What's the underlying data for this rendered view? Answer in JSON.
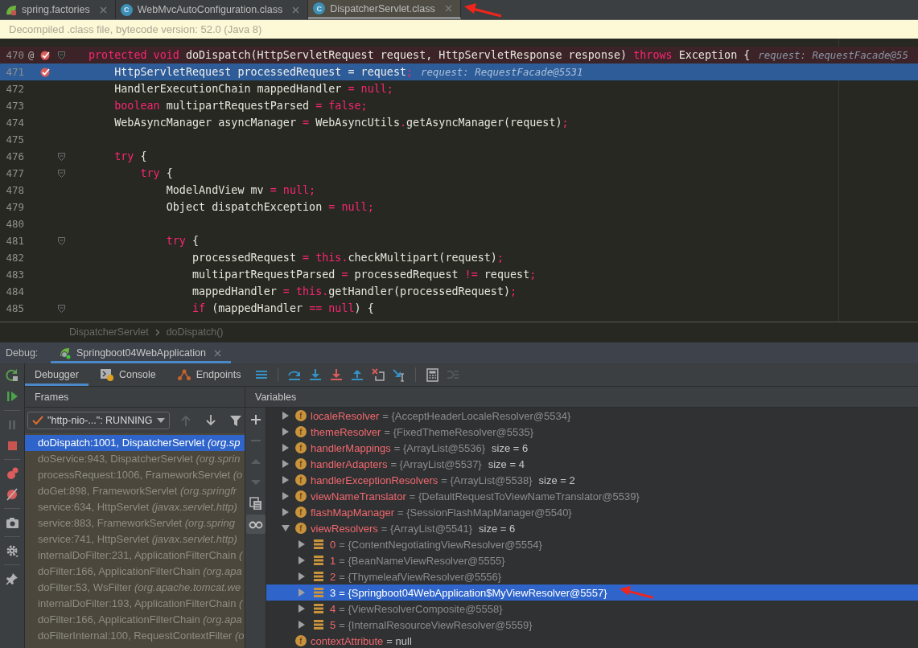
{
  "tabs": [
    {
      "label": "spring.factories",
      "kind": "spring",
      "selected": false,
      "annotated": false
    },
    {
      "label": "WebMvcAutoConfiguration.class",
      "kind": "class",
      "icon_letter": "C",
      "selected": false,
      "annotated": false
    },
    {
      "label": "DispatcherServlet.class",
      "kind": "class",
      "icon_letter": "C",
      "selected": true,
      "annotated": true
    }
  ],
  "banner": "Decompiled .class file, bytecode version: 52.0 (Java 8)",
  "editor": {
    "lines": [
      {
        "number": "470",
        "gutter_mark": "@",
        "breakpoint": true,
        "current": false,
        "fold": true,
        "tokens": [
          {
            "kind": "kw",
            "text": "protected void "
          },
          {
            "kind": "plain",
            "text": "doDispatch(HttpServletRequest request, HttpServletResponse response) "
          },
          {
            "kind": "kw",
            "text": "throws"
          },
          {
            "kind": "plain",
            "text": " Exception {"
          }
        ],
        "hint": "request: RequestFacade@55"
      },
      {
        "number": "471",
        "breakpoint": true,
        "current": true,
        "fold": false,
        "tokens": [
          {
            "kind": "plain",
            "text": "    HttpServletRequest processedRequest = request"
          },
          {
            "kind": "kw",
            "text": ";"
          }
        ],
        "hint": "request: RequestFacade@5531"
      },
      {
        "number": "472",
        "breakpoint": false,
        "current": false,
        "fold": false,
        "tokens": [
          {
            "kind": "plain",
            "text": "    HandlerExecutionChain mappedHandler "
          },
          {
            "kind": "kw",
            "text": "= null;"
          }
        ]
      },
      {
        "number": "473",
        "breakpoint": false,
        "current": false,
        "fold": false,
        "tokens": [
          {
            "kind": "kw",
            "text": "    boolean "
          },
          {
            "kind": "plain",
            "text": "multipartRequestParsed "
          },
          {
            "kind": "kw",
            "text": "= false;"
          }
        ]
      },
      {
        "number": "474",
        "breakpoint": false,
        "current": false,
        "fold": false,
        "tokens": [
          {
            "kind": "plain",
            "text": "    WebAsyncManager asyncManager "
          },
          {
            "kind": "kw",
            "text": "= "
          },
          {
            "kind": "plain",
            "text": "WebAsyncUtils"
          },
          {
            "kind": "kw",
            "text": "."
          },
          {
            "kind": "plain",
            "text": "getAsyncManager(request)"
          },
          {
            "kind": "kw",
            "text": ";"
          }
        ]
      },
      {
        "number": "475",
        "breakpoint": false,
        "current": false,
        "fold": false
      },
      {
        "number": "476",
        "breakpoint": false,
        "current": false,
        "fold": true,
        "tokens": [
          {
            "kind": "kw",
            "text": "    try "
          },
          {
            "kind": "plain",
            "text": "{"
          }
        ]
      },
      {
        "number": "477",
        "breakpoint": false,
        "current": false,
        "fold": true,
        "tokens": [
          {
            "kind": "kw",
            "text": "        try "
          },
          {
            "kind": "plain",
            "text": "{"
          }
        ]
      },
      {
        "number": "478",
        "breakpoint": false,
        "current": false,
        "fold": false,
        "tokens": [
          {
            "kind": "plain",
            "text": "            ModelAndView mv "
          },
          {
            "kind": "kw",
            "text": "= null;"
          }
        ]
      },
      {
        "number": "479",
        "breakpoint": false,
        "current": false,
        "fold": false,
        "tokens": [
          {
            "kind": "plain",
            "text": "            Object dispatchException "
          },
          {
            "kind": "kw",
            "text": "= null;"
          }
        ]
      },
      {
        "number": "480",
        "breakpoint": false,
        "current": false,
        "fold": false
      },
      {
        "number": "481",
        "breakpoint": false,
        "current": false,
        "fold": true,
        "tokens": [
          {
            "kind": "kw",
            "text": "            try "
          },
          {
            "kind": "plain",
            "text": "{"
          }
        ]
      },
      {
        "number": "482",
        "breakpoint": false,
        "current": false,
        "fold": false,
        "tokens": [
          {
            "kind": "plain",
            "text": "                processedRequest "
          },
          {
            "kind": "kw",
            "text": "= this."
          },
          {
            "kind": "plain",
            "text": "checkMultipart(request)"
          },
          {
            "kind": "kw",
            "text": ";"
          }
        ]
      },
      {
        "number": "483",
        "breakpoint": false,
        "current": false,
        "fold": false,
        "tokens": [
          {
            "kind": "plain",
            "text": "                multipartRequestParsed "
          },
          {
            "kind": "kw",
            "text": "= "
          },
          {
            "kind": "plain",
            "text": "processedRequest "
          },
          {
            "kind": "kw",
            "text": "!= "
          },
          {
            "kind": "plain",
            "text": "request"
          },
          {
            "kind": "kw",
            "text": ";"
          }
        ]
      },
      {
        "number": "484",
        "breakpoint": false,
        "current": false,
        "fold": false,
        "tokens": [
          {
            "kind": "plain",
            "text": "                mappedHandler "
          },
          {
            "kind": "kw",
            "text": "= this."
          },
          {
            "kind": "plain",
            "text": "getHandler(processedRequest)"
          },
          {
            "kind": "kw",
            "text": ";"
          }
        ]
      },
      {
        "number": "485",
        "breakpoint": false,
        "current": false,
        "fold": true,
        "tokens": [
          {
            "kind": "kw",
            "text": "                if "
          },
          {
            "kind": "plain",
            "text": "(mappedHandler "
          },
          {
            "kind": "kw",
            "text": "== null"
          },
          {
            "kind": "plain",
            "text": ") {"
          }
        ]
      }
    ]
  },
  "breadcrumb": [
    "DispatcherServlet",
    "doDispatch()"
  ],
  "debug": {
    "label": "Debug:",
    "session": {
      "label": "Springboot04WebApplication",
      "selected": true
    },
    "side_toolbar": [
      {
        "kind": "rerun",
        "disabled": false
      },
      {
        "kind": "resume",
        "disabled": false
      },
      {
        "kind": "pause",
        "disabled": true
      },
      {
        "kind": "stop",
        "disabled": false
      },
      {
        "kind": "breakpoints",
        "disabled": false
      },
      {
        "kind": "mute",
        "disabled": false
      },
      {
        "kind": "camera",
        "disabled": false
      },
      {
        "kind": "settings",
        "disabled": false
      },
      {
        "kind": "pin",
        "disabled": false
      }
    ],
    "tabs": [
      {
        "label": "Debugger",
        "kind": "debugger",
        "selected": true
      },
      {
        "label": "Console",
        "kind": "console",
        "selected": false
      },
      {
        "label": "Endpoints",
        "kind": "endpoints",
        "selected": false
      }
    ],
    "toolbar": [
      {
        "kind": "menu",
        "disabled": false
      },
      {
        "kind": "step-over",
        "disabled": false
      },
      {
        "kind": "step-into",
        "disabled": false
      },
      {
        "kind": "force-step-into",
        "disabled": false
      },
      {
        "kind": "step-out",
        "disabled": false
      },
      {
        "kind": "drop-frame",
        "disabled": false
      },
      {
        "kind": "run-to-cursor",
        "disabled": false
      },
      {
        "kind": "evaluate",
        "disabled": false
      },
      {
        "kind": "trace",
        "disabled": true
      }
    ],
    "frames": {
      "title": "Frames",
      "thread": "\"http-nio-...\": RUNNING",
      "nav": [
        {
          "kind": "up",
          "disabled": true
        },
        {
          "kind": "down",
          "disabled": false
        },
        {
          "kind": "filter",
          "disabled": false
        }
      ],
      "items": [
        {
          "text": "doDispatch:1001, DispatcherServlet",
          "package": "(org.sp",
          "selected": true
        },
        {
          "text": "doService:943, DispatcherServlet",
          "package": "(org.sprin",
          "selected": false
        },
        {
          "text": "processRequest:1006, FrameworkServlet",
          "package": "(o",
          "selected": false
        },
        {
          "text": "doGet:898, FrameworkServlet",
          "package": "(org.springfr",
          "selected": false
        },
        {
          "text": "service:634, HttpServlet",
          "package": "(javax.servlet.http)",
          "selected": false
        },
        {
          "text": "service:883, FrameworkServlet",
          "package": "(org.spring",
          "selected": false
        },
        {
          "text": "service:741, HttpServlet",
          "package": "(javax.servlet.http)",
          "selected": false
        },
        {
          "text": "internalDoFilter:231, ApplicationFilterChain",
          "package": "(",
          "selected": false
        },
        {
          "text": "doFilter:166, ApplicationFilterChain",
          "package": "(org.apa",
          "selected": false
        },
        {
          "text": "doFilter:53, WsFilter",
          "package": "(org.apache.tomcat.we",
          "selected": false
        },
        {
          "text": "internalDoFilter:193, ApplicationFilterChain",
          "package": "(",
          "selected": false
        },
        {
          "text": "doFilter:166, ApplicationFilterChain",
          "package": "(org.apa",
          "selected": false
        },
        {
          "text": "doFilterInternal:100, RequestContextFilter",
          "package": "(o",
          "selected": false
        }
      ]
    },
    "variables": {
      "title": "Variables",
      "toolbar": [
        {
          "kind": "add",
          "disabled": false
        },
        {
          "kind": "remove",
          "disabled": true
        },
        {
          "kind": "up",
          "disabled": true
        },
        {
          "kind": "down",
          "disabled": true
        },
        {
          "kind": "copy",
          "disabled": false
        },
        {
          "kind": "watches",
          "disabled": false,
          "selected": true
        }
      ],
      "items": [
        {
          "kind": "field",
          "icon_letter": "f",
          "name": "localeResolver",
          "value": "= {AcceptHeaderLocaleResolver@5534}",
          "expanded": false,
          "selected": false
        },
        {
          "kind": "field",
          "icon_letter": "f",
          "name": "themeResolver",
          "value": "= {FixedThemeResolver@5535}",
          "expanded": false,
          "selected": false
        },
        {
          "kind": "field",
          "icon_letter": "f",
          "name": "handlerMappings",
          "value": "= {ArrayList@5536}",
          "size": "size = 6",
          "expanded": false,
          "selected": false
        },
        {
          "kind": "field",
          "icon_letter": "f",
          "name": "handlerAdapters",
          "value": "= {ArrayList@5537}",
          "size": "size = 4",
          "expanded": false,
          "selected": false
        },
        {
          "kind": "field",
          "icon_letter": "f",
          "name": "handlerExceptionResolvers",
          "value": "= {ArrayList@5538}",
          "size": "size = 2",
          "expanded": false,
          "selected": false
        },
        {
          "kind": "field",
          "icon_letter": "f",
          "name": "viewNameTranslator",
          "value": "= {DefaultRequestToViewNameTranslator@5539}",
          "expanded": false,
          "selected": false
        },
        {
          "kind": "field",
          "icon_letter": "f",
          "name": "flashMapManager",
          "value": "= {SessionFlashMapManager@5540}",
          "expanded": false,
          "selected": false
        },
        {
          "kind": "field",
          "icon_letter": "f",
          "name": "viewResolvers",
          "value": "= {ArrayList@5541}",
          "size": "size = 6",
          "expanded": true,
          "selected": false,
          "children": [
            {
              "kind": "element",
              "name": "0",
              "value": "= {ContentNegotiatingViewResolver@5554}",
              "expanded": false,
              "selected": false
            },
            {
              "kind": "element",
              "name": "1",
              "value": "= {BeanNameViewResolver@5555}",
              "expanded": false,
              "selected": false
            },
            {
              "kind": "element",
              "name": "2",
              "value": "= {ThymeleafViewResolver@5556}",
              "expanded": false,
              "selected": false
            },
            {
              "kind": "element",
              "name": "3",
              "value": "= {Springboot04WebApplication$MyViewResolver@5557}",
              "expanded": false,
              "selected": true,
              "annotated": true
            },
            {
              "kind": "element",
              "name": "4",
              "value": "= {ViewResolverComposite@5558}",
              "expanded": false,
              "selected": false
            },
            {
              "kind": "element",
              "name": "5",
              "value": "= {InternalResourceViewResolver@5559}",
              "expanded": false,
              "selected": false
            }
          ]
        },
        {
          "kind": "field",
          "icon_letter": "f",
          "name": "contextAttribute",
          "value": "= null",
          "selected": false
        }
      ]
    }
  }
}
